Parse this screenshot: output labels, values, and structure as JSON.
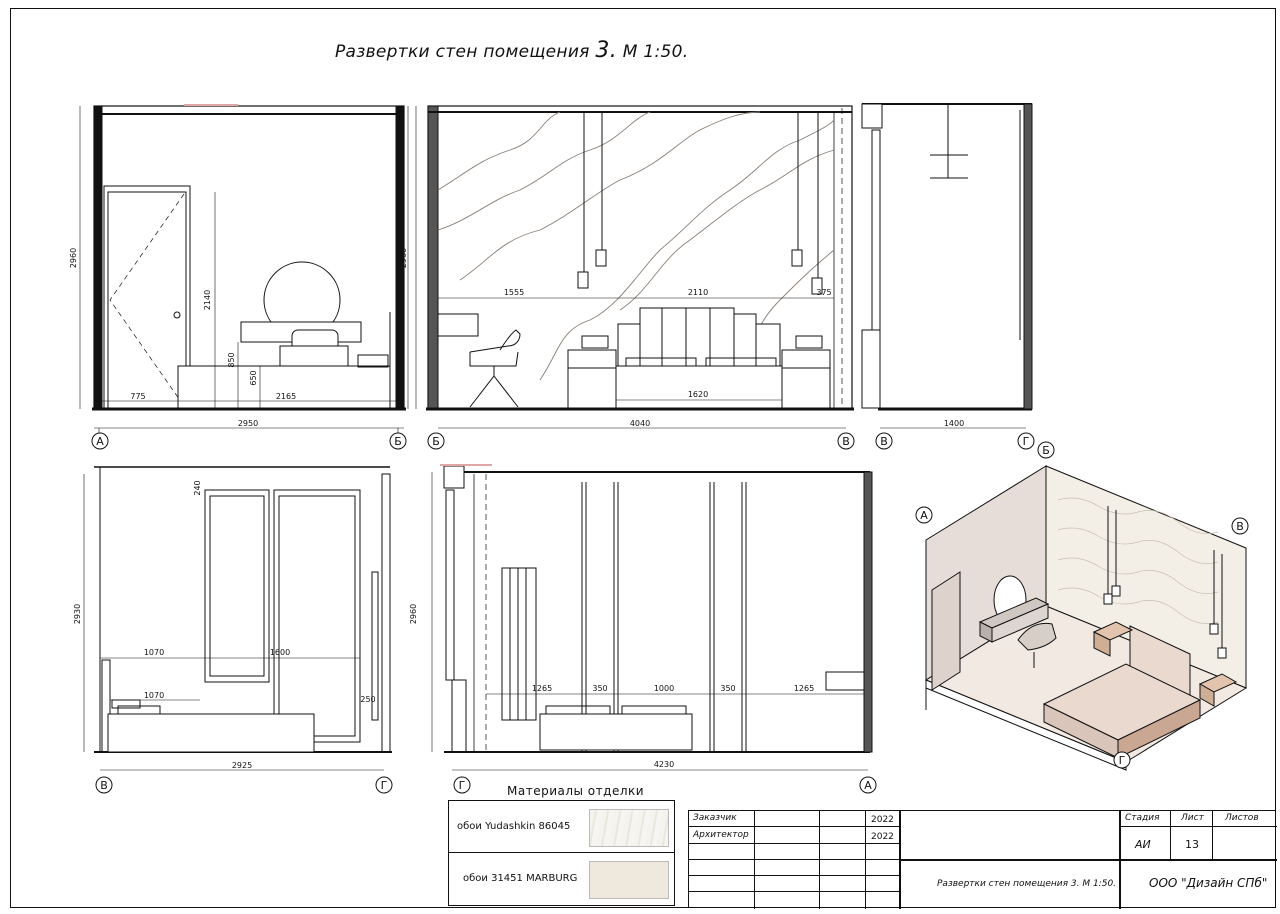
{
  "title": {
    "prefix": "Развертки стен помещения ",
    "num": "3.",
    "suffix": " М 1:50."
  },
  "axes": {
    "A": "А",
    "B": "Б",
    "V": "В",
    "G": "Г"
  },
  "elev1": {
    "dims": {
      "height": "2960",
      "height_r": "2960",
      "door_h": "2140",
      "h850": "850",
      "h650": "650",
      "w775": "775",
      "w2165": "2165",
      "total": "2950"
    }
  },
  "elev2": {
    "dims": {
      "height": "2960",
      "w1555": "1555",
      "w2110": "2110",
      "w375": "375",
      "bed": "1620",
      "total": "4040"
    }
  },
  "elev3": {
    "dims": {
      "total": "1400"
    }
  },
  "elev4": {
    "dims": {
      "height": "2930",
      "h240": "240",
      "w1070a": "1070",
      "w1600": "1600",
      "w1070b": "1070",
      "h250": "250",
      "total": "2925"
    }
  },
  "elev5": {
    "dims": {
      "height": "2960",
      "w1265a": "1265",
      "w350a": "350",
      "w1000": "1000",
      "w350b": "350",
      "w1265b": "1265",
      "total": "4230"
    }
  },
  "materials": {
    "title": "Материалы отделки",
    "items": [
      {
        "label": "обои Yudashkin 86045"
      },
      {
        "label": "обои 31451 MARBURG"
      }
    ]
  },
  "title_block": {
    "customer": "Заказчик",
    "architect": "Архитектор",
    "year1": "2022",
    "year2": "2022",
    "stage_h": "Стадия",
    "sheet_h": "Лист",
    "sheets_h": "Листов",
    "stage": "АИ",
    "sheet": "13",
    "sheet_title": "Развертки стен помещения 3. М 1:50.",
    "company": "ООО \"Дизайн СПб\""
  },
  "colors": {
    "line": "#111111",
    "wall_fill": "#e7ddd8",
    "wall_pattern": "#f3efe6",
    "floor": "#f2e9e2",
    "bed": "#ead9cf",
    "accent": "#c9a793"
  }
}
